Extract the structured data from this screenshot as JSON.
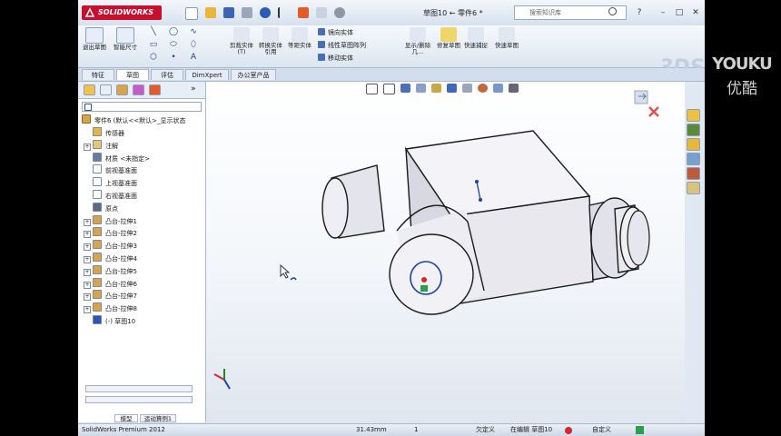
{
  "app": {
    "name": "SOLIDWORKS",
    "document_title": "草图10 ← 零件6 *",
    "search_placeholder": "搜索知识库",
    "help_label": "?",
    "minimize": "–",
    "restore": "□",
    "close": "✕"
  },
  "command_manager": {
    "exit_sketch": "退出草图",
    "smart_dimension": "智能尺寸",
    "trim_entities": "剪裁实体(T)",
    "convert_entities": "转换实体引用",
    "offset_entities": "等距实体",
    "mirror_entities": "镜向实体",
    "linear_pattern": "线性草图阵列",
    "move_entities": "移动实体",
    "display_relations": "显示/删除几...",
    "repair_sketch": "修复草图",
    "quick_snaps": "快速捕捉",
    "rapid_sketch": "快速草图",
    "brand_mark": "3DS"
  },
  "tabs": [
    "特征",
    "草图",
    "评估",
    "DimXpert",
    "办公室产品"
  ],
  "active_tab": 1,
  "feature_tree": {
    "root": "零件6 (默认<<默认>_显示状态",
    "items": [
      {
        "label": "传感器",
        "icon": "sensor-icon",
        "expandable": false
      },
      {
        "label": "注解",
        "icon": "annotation-icon",
        "expandable": true
      },
      {
        "label": "材质 <未指定>",
        "icon": "material-icon",
        "expandable": false
      },
      {
        "label": "前视基准面",
        "icon": "plane-icon",
        "expandable": false
      },
      {
        "label": "上视基准面",
        "icon": "plane-icon",
        "expandable": false
      },
      {
        "label": "右视基准面",
        "icon": "plane-icon",
        "expandable": false
      },
      {
        "label": "原点",
        "icon": "origin-icon",
        "expandable": false
      },
      {
        "label": "凸台-拉伸1",
        "icon": "extrude-icon",
        "expandable": true
      },
      {
        "label": "凸台-拉伸2",
        "icon": "extrude-icon",
        "expandable": true
      },
      {
        "label": "凸台-拉伸3",
        "icon": "extrude-icon",
        "expandable": true
      },
      {
        "label": "凸台-拉伸4",
        "icon": "extrude-icon",
        "expandable": true
      },
      {
        "label": "凸台-拉伸5",
        "icon": "extrude-icon",
        "expandable": true
      },
      {
        "label": "凸台-拉伸6",
        "icon": "extrude-icon",
        "expandable": true
      },
      {
        "label": "凸台-拉伸7",
        "icon": "extrude-icon",
        "expandable": true
      },
      {
        "label": "凸台-拉伸8",
        "icon": "extrude-icon",
        "expandable": true
      },
      {
        "label": "(-) 草图10",
        "icon": "sketch-icon",
        "expandable": false
      }
    ]
  },
  "bottom_tabs": [
    "模型",
    "运动算例1"
  ],
  "status_bar": {
    "product": "SolidWorks Premium 2012",
    "measure": "31.43mm",
    "count": "1",
    "state": "欠定义",
    "editing": "在编辑 草图10",
    "units": "自定义"
  },
  "colors": {
    "brand_red": "#c8102e",
    "sketch_blue": "#1b3fb0",
    "part_face": "#e6e6ee",
    "part_edge": "#1a1a1a"
  },
  "watermark": {
    "line1": "YOUKU",
    "line2": "优酷"
  }
}
